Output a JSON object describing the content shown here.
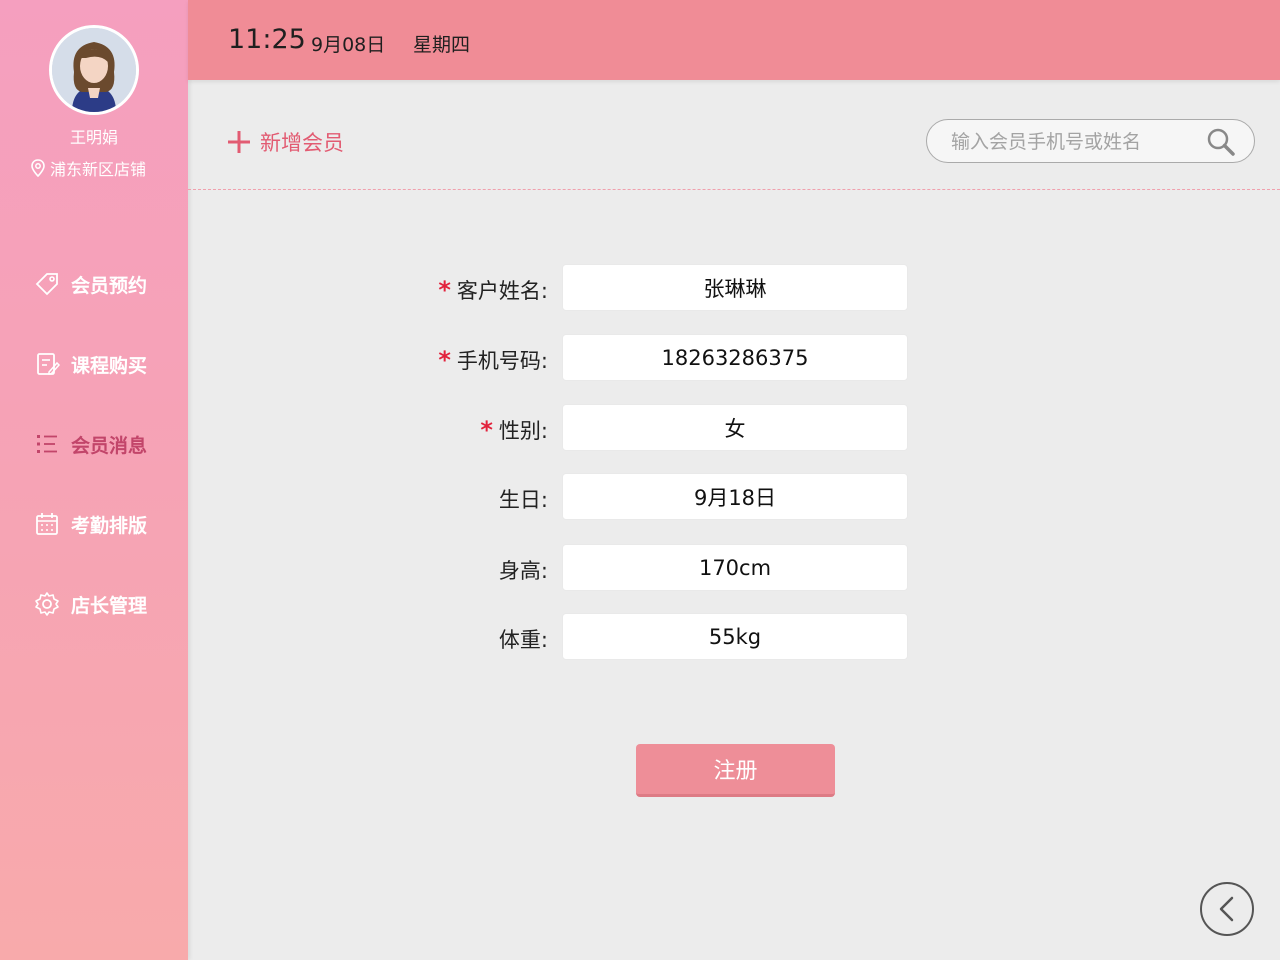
{
  "sidebar": {
    "user_name": "王明娟",
    "store": "浦东新区店铺",
    "items": [
      {
        "label": "会员预约",
        "icon": "tag-icon"
      },
      {
        "label": "课程购买",
        "icon": "document-edit-icon"
      },
      {
        "label": "会员消息",
        "icon": "list-icon"
      },
      {
        "label": "考勤排版",
        "icon": "calendar-icon"
      },
      {
        "label": "店长管理",
        "icon": "gear-icon"
      }
    ]
  },
  "header": {
    "time": "11:25",
    "date": "9月08日",
    "weekday": "星期四"
  },
  "toolbar": {
    "add_member_label": "新增会员",
    "search_placeholder": "输入会员手机号或姓名"
  },
  "form": {
    "fields": [
      {
        "label": "客户姓名:",
        "value": "张琳琳"
      },
      {
        "label": "手机号码:",
        "value": "18263286375"
      },
      {
        "label": "性别:",
        "value": "女"
      },
      {
        "label": "生日:",
        "value": "9月18日"
      },
      {
        "label": "身高:",
        "value": "170cm"
      },
      {
        "label": "体重:",
        "value": "55kg"
      }
    ],
    "required_mark": "*",
    "submit_label": "注册"
  },
  "colors": {
    "header_bg": "#f08c96",
    "accent": "#e25b72",
    "active_nav": "#c2456a",
    "required": "#e2223c"
  }
}
